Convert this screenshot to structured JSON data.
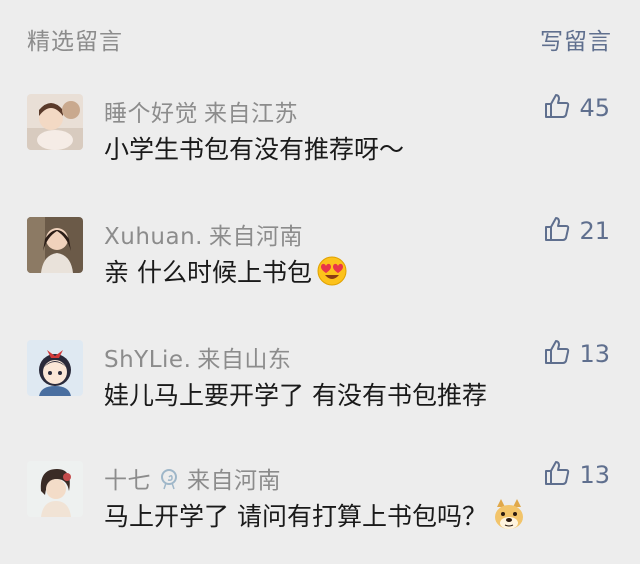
{
  "header": {
    "title": "精选留言",
    "write_label": "写留言"
  },
  "comments": [
    {
      "nickname": "睡个好觉",
      "location": "来自江苏",
      "text": "小学生书包有没有推荐呀～",
      "likes": "45"
    },
    {
      "nickname": "Xuhuan.",
      "location": "来自河南",
      "text": "亲 什么时候上书包",
      "likes": "21",
      "emoji": "heart-eyes-emoji"
    },
    {
      "nickname": "ShYLie.",
      "location": "来自山东",
      "text": "娃儿马上要开学了 有没有书包推荐",
      "likes": "13"
    },
    {
      "nickname": "十七",
      "location": "来自河南",
      "text": "马上开学了 请问有打算上书包吗？",
      "likes": "13",
      "emoji": "doge-emoji"
    }
  ],
  "icons": {
    "like": "thumbs-up-icon"
  },
  "colors": {
    "background": "#ededed",
    "link": "#5f6f8e",
    "muted": "#8c8c8c",
    "text": "#1a1a1a"
  }
}
